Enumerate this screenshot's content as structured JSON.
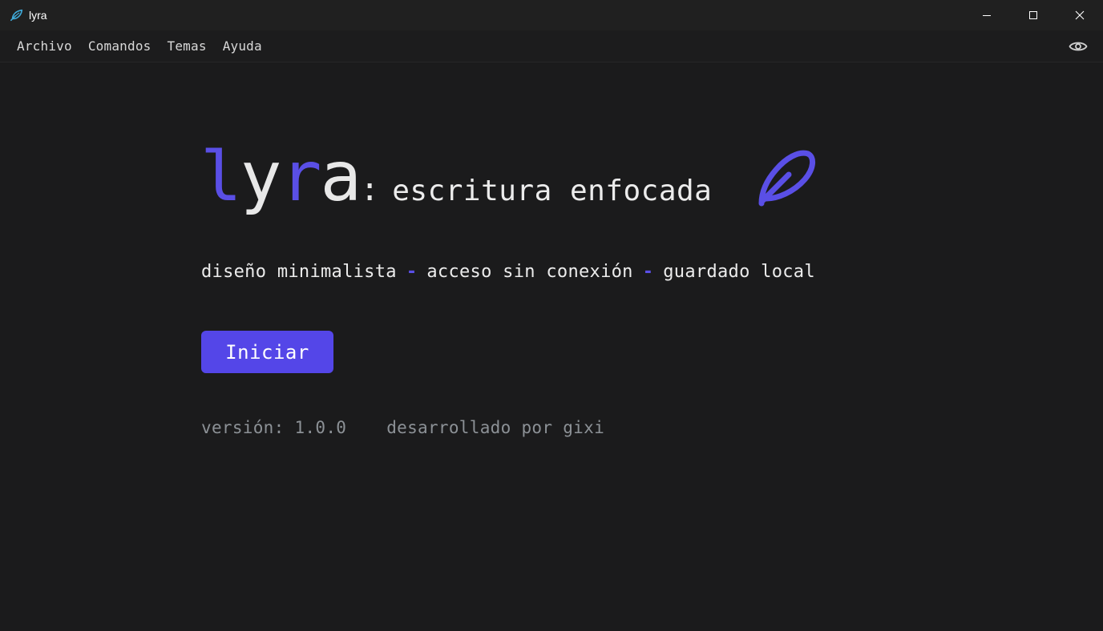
{
  "window": {
    "title": "lyra"
  },
  "menu": {
    "items": [
      {
        "label": "Archivo"
      },
      {
        "label": "Comandos"
      },
      {
        "label": "Temas"
      },
      {
        "label": "Ayuda"
      }
    ]
  },
  "hero": {
    "logo_part1": "l",
    "logo_part2": "y",
    "logo_part3": "r",
    "logo_part4": "a",
    "colon": ":",
    "tagline": "escritura enfocada",
    "icon": "feather-icon"
  },
  "features": {
    "items": [
      "diseño minimalista",
      "acceso sin conexión",
      "guardado local"
    ],
    "separator": "-"
  },
  "start_button": {
    "label": "Iniciar"
  },
  "footer": {
    "version": "versión: 1.0.0",
    "credit": "desarrollado por gixi"
  },
  "colors": {
    "accent": "#5446e8",
    "background": "#1b1b1c",
    "text": "#e8e8e8",
    "muted": "#8c9196"
  }
}
